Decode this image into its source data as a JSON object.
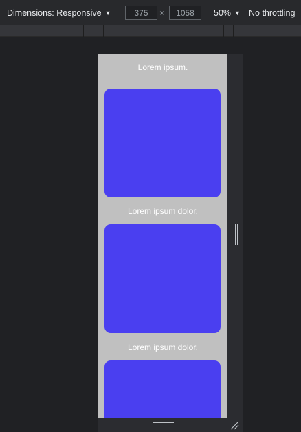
{
  "toolbar": {
    "dimensions_label": "Dimensions: Responsive",
    "width_value": "375",
    "height_value": "1058",
    "times_symbol": "×",
    "zoom_label": "50%",
    "throttling_label": "No throttling",
    "caret": "▼"
  },
  "viewport": {
    "paragraphs": [
      "Lorem ipsum.",
      "Lorem ipsum dolor.",
      "Lorem ipsum dolor."
    ]
  },
  "colors": {
    "viewport_bg": "#c0c0c0",
    "card": "#4a3ff0",
    "devtools_bg": "#202124"
  }
}
